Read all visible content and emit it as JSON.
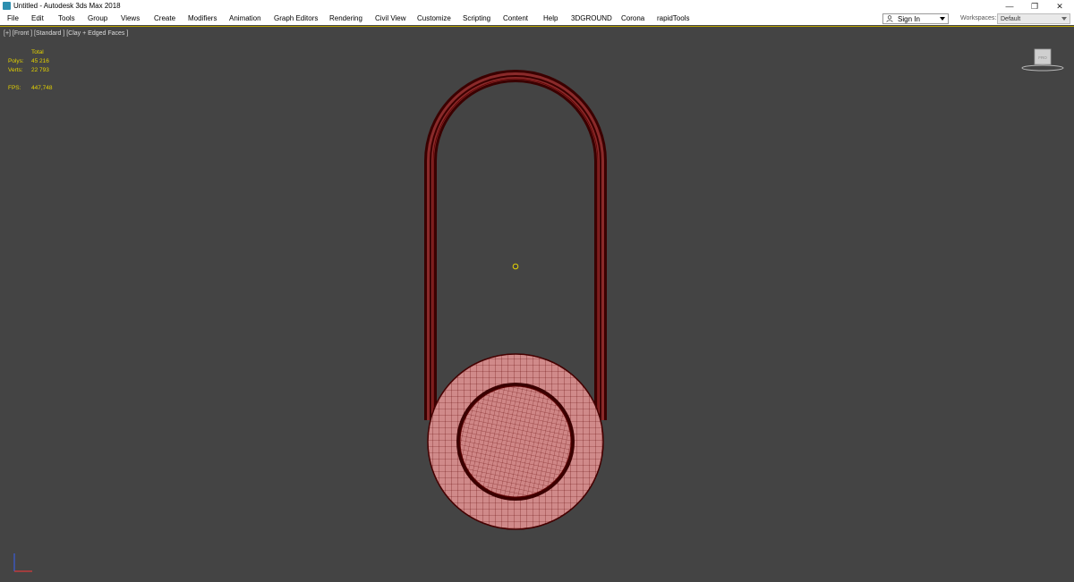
{
  "window": {
    "title": "Untitled - Autodesk 3ds Max 2018",
    "minimize_glyph": "—",
    "restore_glyph": "❐",
    "close_glyph": "✕"
  },
  "menu": {
    "items": [
      "File",
      "Edit",
      "Tools",
      "Group",
      "Views",
      "Create",
      "Modifiers",
      "Animation",
      "Graph Editors",
      "Rendering",
      "Civil View",
      "Customize",
      "Scripting",
      "Content",
      "Help",
      "3DGROUND",
      "Corona",
      "rapidTools"
    ],
    "signin": "Sign In",
    "workspaces_label": "Workspaces:",
    "workspaces_value": "Default"
  },
  "viewport": {
    "label": "[+] [Front ] [Standard ] [Clay + Edged Faces ]",
    "stats": {
      "header": "Total",
      "polys_label": "Polys:",
      "polys_value": "45 216",
      "verts_label": "Verts:",
      "verts_value": "22 793",
      "fps_label": "FPS:",
      "fps_value": "447,748"
    },
    "viewcube_label": "FRO"
  },
  "colors": {
    "viewport_bg": "#444444",
    "stats_text": "#e4d200",
    "model_fill": "#d08a8a",
    "wire": "#5a0000",
    "active_border": "#b8a000"
  },
  "icons": [
    "app-icon",
    "user-icon",
    "viewcube-icon",
    "axis-tripod-icon",
    "pivot-marker-icon"
  ]
}
